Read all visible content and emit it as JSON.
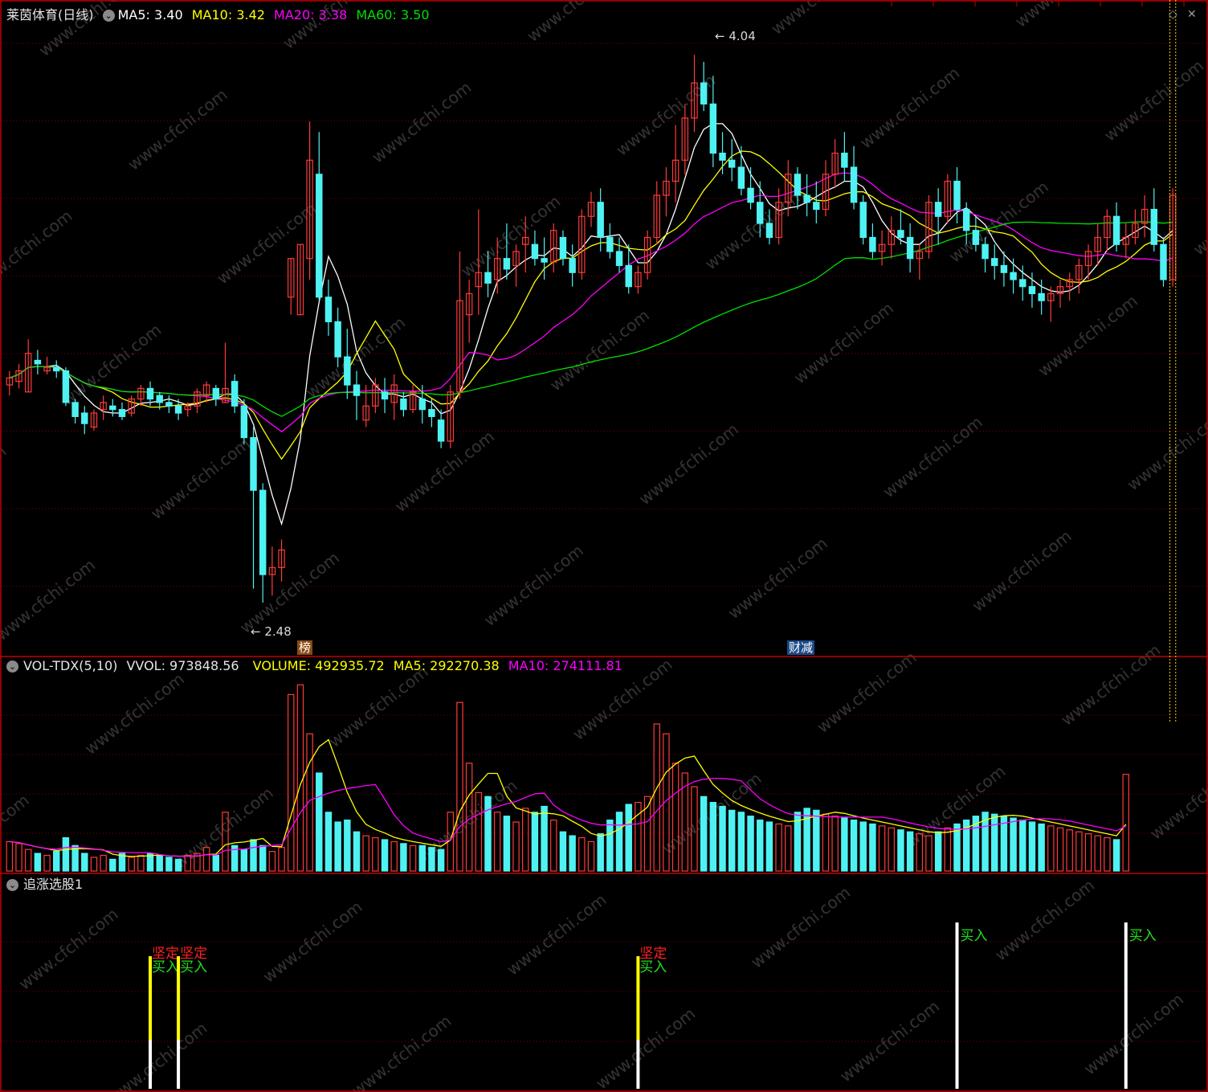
{
  "header": {
    "title": "莱茵体育",
    "period": "(日线)",
    "ma": [
      {
        "label": "MA5: 3.40",
        "color": "#ffffff"
      },
      {
        "label": "MA10: 3.42",
        "color": "#ffff00"
      },
      {
        "label": "MA20: 3.38",
        "color": "#ff00ff"
      },
      {
        "label": "MA60: 3.50",
        "color": "#00e000"
      }
    ]
  },
  "price_panel": {
    "high_label": "4.04",
    "low_label": "2.48",
    "tags": [
      "榜",
      "财减"
    ]
  },
  "volume_panel": {
    "name": "VOL-TDX(5,10)",
    "vvol": "VVOL: 973848.56",
    "volume": "VOLUME: 492935.72",
    "ma5": "MA5: 292270.38",
    "ma10": "MA10: 274111.81"
  },
  "signal_panel": {
    "name": "追涨选股1"
  },
  "watermark": "www.cfchi.com",
  "colors": {
    "up": "#ff3a3a",
    "down": "#4ff2f2",
    "frame": "#c00000",
    "grid": "#7a0000",
    "ma5": "#ffffff",
    "ma10": "#ffff00",
    "ma20": "#ff00ff",
    "ma60": "#00e000"
  },
  "chart_data": {
    "type": "candlestick",
    "ylim": [
      2.4,
      4.1
    ],
    "ylim_volume": [
      0,
      1000000
    ],
    "candles": [
      {
        "o": 3.1,
        "h": 3.14,
        "l": 3.07,
        "c": 3.12
      },
      {
        "o": 3.11,
        "h": 3.16,
        "l": 3.09,
        "c": 3.14
      },
      {
        "o": 3.08,
        "h": 3.23,
        "l": 3.08,
        "c": 3.19
      },
      {
        "o": 3.17,
        "h": 3.2,
        "l": 3.13,
        "c": 3.16
      },
      {
        "o": 3.14,
        "h": 3.18,
        "l": 3.13,
        "c": 3.15
      },
      {
        "o": 3.15,
        "h": 3.17,
        "l": 3.12,
        "c": 3.14
      },
      {
        "o": 3.14,
        "h": 3.15,
        "l": 3.04,
        "c": 3.05
      },
      {
        "o": 3.05,
        "h": 3.06,
        "l": 2.99,
        "c": 3.01
      },
      {
        "o": 3.02,
        "h": 3.04,
        "l": 2.96,
        "c": 2.99
      },
      {
        "o": 2.98,
        "h": 3.03,
        "l": 2.97,
        "c": 3.02
      },
      {
        "o": 3.03,
        "h": 3.07,
        "l": 3.0,
        "c": 3.05
      },
      {
        "o": 3.04,
        "h": 3.06,
        "l": 3.01,
        "c": 3.03
      },
      {
        "o": 3.03,
        "h": 3.05,
        "l": 3.0,
        "c": 3.01
      },
      {
        "o": 3.02,
        "h": 3.07,
        "l": 3.01,
        "c": 3.06
      },
      {
        "o": 3.06,
        "h": 3.1,
        "l": 3.04,
        "c": 3.09
      },
      {
        "o": 3.09,
        "h": 3.11,
        "l": 3.04,
        "c": 3.06
      },
      {
        "o": 3.07,
        "h": 3.08,
        "l": 3.03,
        "c": 3.05
      },
      {
        "o": 3.05,
        "h": 3.07,
        "l": 3.02,
        "c": 3.04
      },
      {
        "o": 3.04,
        "h": 3.06,
        "l": 3.0,
        "c": 3.02
      },
      {
        "o": 3.03,
        "h": 3.05,
        "l": 3.01,
        "c": 3.04
      },
      {
        "o": 3.04,
        "h": 3.09,
        "l": 3.02,
        "c": 3.08
      },
      {
        "o": 3.07,
        "h": 3.11,
        "l": 3.05,
        "c": 3.1
      },
      {
        "o": 3.09,
        "h": 3.1,
        "l": 3.04,
        "c": 3.06
      },
      {
        "o": 3.05,
        "h": 3.22,
        "l": 3.05,
        "c": 3.09
      },
      {
        "o": 3.11,
        "h": 3.13,
        "l": 3.02,
        "c": 3.04
      },
      {
        "o": 3.04,
        "h": 3.06,
        "l": 2.93,
        "c": 2.95
      },
      {
        "o": 2.95,
        "h": 2.98,
        "l": 2.52,
        "c": 2.8
      },
      {
        "o": 2.8,
        "h": 2.82,
        "l": 2.48,
        "c": 2.56
      },
      {
        "o": 2.56,
        "h": 2.64,
        "l": 2.5,
        "c": 2.58
      },
      {
        "o": 2.58,
        "h": 2.66,
        "l": 2.54,
        "c": 2.63
      },
      {
        "o": 3.35,
        "h": 3.46,
        "l": 3.3,
        "c": 3.46
      },
      {
        "o": 3.3,
        "h": 3.5,
        "l": 3.3,
        "c": 3.5
      },
      {
        "o": 3.46,
        "h": 3.85,
        "l": 3.4,
        "c": 3.74
      },
      {
        "o": 3.7,
        "h": 3.82,
        "l": 3.34,
        "c": 3.35
      },
      {
        "o": 3.35,
        "h": 3.4,
        "l": 3.24,
        "c": 3.28
      },
      {
        "o": 3.28,
        "h": 3.32,
        "l": 3.15,
        "c": 3.18
      },
      {
        "o": 3.18,
        "h": 3.26,
        "l": 3.06,
        "c": 3.1
      },
      {
        "o": 3.1,
        "h": 3.14,
        "l": 3.0,
        "c": 3.07
      },
      {
        "o": 3.0,
        "h": 3.1,
        "l": 2.98,
        "c": 3.04
      },
      {
        "o": 3.04,
        "h": 3.12,
        "l": 3.02,
        "c": 3.1
      },
      {
        "o": 3.08,
        "h": 3.12,
        "l": 3.02,
        "c": 3.06
      },
      {
        "o": 3.05,
        "h": 3.13,
        "l": 3.0,
        "c": 3.1
      },
      {
        "o": 3.06,
        "h": 3.08,
        "l": 3.01,
        "c": 3.03
      },
      {
        "o": 3.03,
        "h": 3.1,
        "l": 3.02,
        "c": 3.08
      },
      {
        "o": 3.06,
        "h": 3.1,
        "l": 2.99,
        "c": 3.03
      },
      {
        "o": 3.03,
        "h": 3.06,
        "l": 2.98,
        "c": 3.01
      },
      {
        "o": 3.0,
        "h": 3.03,
        "l": 2.92,
        "c": 2.94
      },
      {
        "o": 2.94,
        "h": 3.1,
        "l": 2.92,
        "c": 3.08
      },
      {
        "o": 3.08,
        "h": 3.48,
        "l": 3.06,
        "c": 3.34
      },
      {
        "o": 3.3,
        "h": 3.4,
        "l": 3.22,
        "c": 3.36
      },
      {
        "o": 3.38,
        "h": 3.6,
        "l": 3.3,
        "c": 3.42
      },
      {
        "o": 3.42,
        "h": 3.48,
        "l": 3.35,
        "c": 3.39
      },
      {
        "o": 3.4,
        "h": 3.52,
        "l": 3.36,
        "c": 3.46
      },
      {
        "o": 3.46,
        "h": 3.56,
        "l": 3.4,
        "c": 3.43
      },
      {
        "o": 3.44,
        "h": 3.5,
        "l": 3.38,
        "c": 3.48
      },
      {
        "o": 3.5,
        "h": 3.58,
        "l": 3.42,
        "c": 3.52
      },
      {
        "o": 3.5,
        "h": 3.54,
        "l": 3.44,
        "c": 3.46
      },
      {
        "o": 3.46,
        "h": 3.52,
        "l": 3.4,
        "c": 3.45
      },
      {
        "o": 3.45,
        "h": 3.56,
        "l": 3.42,
        "c": 3.54
      },
      {
        "o": 3.52,
        "h": 3.54,
        "l": 3.44,
        "c": 3.46
      },
      {
        "o": 3.46,
        "h": 3.5,
        "l": 3.38,
        "c": 3.42
      },
      {
        "o": 3.42,
        "h": 3.6,
        "l": 3.4,
        "c": 3.58
      },
      {
        "o": 3.58,
        "h": 3.65,
        "l": 3.55,
        "c": 3.62
      },
      {
        "o": 3.62,
        "h": 3.66,
        "l": 3.48,
        "c": 3.52
      },
      {
        "o": 3.52,
        "h": 3.56,
        "l": 3.46,
        "c": 3.48
      },
      {
        "o": 3.48,
        "h": 3.52,
        "l": 3.42,
        "c": 3.44
      },
      {
        "o": 3.44,
        "h": 3.5,
        "l": 3.36,
        "c": 3.38
      },
      {
        "o": 3.38,
        "h": 3.44,
        "l": 3.36,
        "c": 3.42
      },
      {
        "o": 3.42,
        "h": 3.54,
        "l": 3.4,
        "c": 3.52
      },
      {
        "o": 3.52,
        "h": 3.68,
        "l": 3.5,
        "c": 3.64
      },
      {
        "o": 3.64,
        "h": 3.72,
        "l": 3.58,
        "c": 3.68
      },
      {
        "o": 3.68,
        "h": 3.84,
        "l": 3.62,
        "c": 3.74
      },
      {
        "o": 3.74,
        "h": 3.9,
        "l": 3.7,
        "c": 3.86
      },
      {
        "o": 3.86,
        "h": 4.04,
        "l": 3.82,
        "c": 3.96
      },
      {
        "o": 3.96,
        "h": 4.02,
        "l": 3.88,
        "c": 3.9
      },
      {
        "o": 3.9,
        "h": 3.98,
        "l": 3.72,
        "c": 3.76
      },
      {
        "o": 3.76,
        "h": 3.82,
        "l": 3.7,
        "c": 3.74
      },
      {
        "o": 3.74,
        "h": 3.8,
        "l": 3.68,
        "c": 3.72
      },
      {
        "o": 3.72,
        "h": 3.78,
        "l": 3.64,
        "c": 3.66
      },
      {
        "o": 3.66,
        "h": 3.72,
        "l": 3.6,
        "c": 3.62
      },
      {
        "o": 3.62,
        "h": 3.68,
        "l": 3.52,
        "c": 3.56
      },
      {
        "o": 3.56,
        "h": 3.6,
        "l": 3.5,
        "c": 3.52
      },
      {
        "o": 3.52,
        "h": 3.66,
        "l": 3.5,
        "c": 3.62
      },
      {
        "o": 3.62,
        "h": 3.74,
        "l": 3.58,
        "c": 3.7
      },
      {
        "o": 3.7,
        "h": 3.72,
        "l": 3.6,
        "c": 3.64
      },
      {
        "o": 3.64,
        "h": 3.7,
        "l": 3.58,
        "c": 3.62
      },
      {
        "o": 3.62,
        "h": 3.68,
        "l": 3.56,
        "c": 3.6
      },
      {
        "o": 3.6,
        "h": 3.74,
        "l": 3.58,
        "c": 3.7
      },
      {
        "o": 3.7,
        "h": 3.8,
        "l": 3.66,
        "c": 3.76
      },
      {
        "o": 3.76,
        "h": 3.82,
        "l": 3.68,
        "c": 3.72
      },
      {
        "o": 3.72,
        "h": 3.78,
        "l": 3.6,
        "c": 3.62
      },
      {
        "o": 3.62,
        "h": 3.64,
        "l": 3.5,
        "c": 3.52
      },
      {
        "o": 3.52,
        "h": 3.56,
        "l": 3.46,
        "c": 3.48
      },
      {
        "o": 3.48,
        "h": 3.54,
        "l": 3.44,
        "c": 3.5
      },
      {
        "o": 3.5,
        "h": 3.58,
        "l": 3.46,
        "c": 3.54
      },
      {
        "o": 3.54,
        "h": 3.6,
        "l": 3.5,
        "c": 3.52
      },
      {
        "o": 3.52,
        "h": 3.56,
        "l": 3.42,
        "c": 3.46
      },
      {
        "o": 3.46,
        "h": 3.5,
        "l": 3.4,
        "c": 3.48
      },
      {
        "o": 3.48,
        "h": 3.64,
        "l": 3.46,
        "c": 3.62
      },
      {
        "o": 3.62,
        "h": 3.66,
        "l": 3.5,
        "c": 3.58
      },
      {
        "o": 3.58,
        "h": 3.7,
        "l": 3.56,
        "c": 3.68
      },
      {
        "o": 3.68,
        "h": 3.72,
        "l": 3.56,
        "c": 3.6
      },
      {
        "o": 3.6,
        "h": 3.62,
        "l": 3.5,
        "c": 3.54
      },
      {
        "o": 3.54,
        "h": 3.58,
        "l": 3.48,
        "c": 3.5
      },
      {
        "o": 3.5,
        "h": 3.52,
        "l": 3.42,
        "c": 3.46
      },
      {
        "o": 3.46,
        "h": 3.5,
        "l": 3.4,
        "c": 3.44
      },
      {
        "o": 3.44,
        "h": 3.48,
        "l": 3.38,
        "c": 3.42
      },
      {
        "o": 3.42,
        "h": 3.46,
        "l": 3.36,
        "c": 3.4
      },
      {
        "o": 3.4,
        "h": 3.44,
        "l": 3.34,
        "c": 3.38
      },
      {
        "o": 3.38,
        "h": 3.42,
        "l": 3.32,
        "c": 3.36
      },
      {
        "o": 3.36,
        "h": 3.4,
        "l": 3.3,
        "c": 3.34
      },
      {
        "o": 3.34,
        "h": 3.38,
        "l": 3.28,
        "c": 3.36
      },
      {
        "o": 3.36,
        "h": 3.4,
        "l": 3.32,
        "c": 3.38
      },
      {
        "o": 3.38,
        "h": 3.42,
        "l": 3.34,
        "c": 3.4
      },
      {
        "o": 3.4,
        "h": 3.46,
        "l": 3.36,
        "c": 3.44
      },
      {
        "o": 3.44,
        "h": 3.5,
        "l": 3.4,
        "c": 3.48
      },
      {
        "o": 3.48,
        "h": 3.56,
        "l": 3.44,
        "c": 3.52
      },
      {
        "o": 3.52,
        "h": 3.6,
        "l": 3.48,
        "c": 3.58
      },
      {
        "o": 3.58,
        "h": 3.62,
        "l": 3.48,
        "c": 3.5
      },
      {
        "o": 3.5,
        "h": 3.56,
        "l": 3.46,
        "c": 3.52
      },
      {
        "o": 3.52,
        "h": 3.6,
        "l": 3.5,
        "c": 3.56
      },
      {
        "o": 3.56,
        "h": 3.64,
        "l": 3.52,
        "c": 3.6
      },
      {
        "o": 3.6,
        "h": 3.66,
        "l": 3.48,
        "c": 3.5
      },
      {
        "o": 3.5,
        "h": 3.52,
        "l": 3.38,
        "c": 3.4
      },
      {
        "o": 3.4,
        "h": 3.66,
        "l": 3.38,
        "c": 3.64
      }
    ],
    "volumes": [
      150000,
      140000,
      110000,
      90000,
      80000,
      100000,
      170000,
      130000,
      90000,
      70000,
      80000,
      60000,
      90000,
      70000,
      80000,
      90000,
      80000,
      70000,
      60000,
      80000,
      90000,
      120000,
      80000,
      300000,
      130000,
      110000,
      160000,
      130000,
      100000,
      120000,
      900000,
      950000,
      700000,
      500000,
      300000,
      250000,
      260000,
      200000,
      180000,
      170000,
      160000,
      150000,
      140000,
      130000,
      130000,
      120000,
      110000,
      300000,
      860000,
      550000,
      400000,
      380000,
      300000,
      280000,
      250000,
      320000,
      300000,
      330000,
      260000,
      200000,
      180000,
      170000,
      150000,
      190000,
      260000,
      300000,
      340000,
      350000,
      380000,
      750000,
      700000,
      550000,
      500000,
      430000,
      380000,
      350000,
      330000,
      310000,
      300000,
      280000,
      260000,
      250000,
      240000,
      230000,
      300000,
      320000,
      310000,
      290000,
      280000,
      270000,
      260000,
      250000,
      240000,
      230000,
      220000,
      210000,
      200000,
      190000,
      180000,
      200000,
      220000,
      240000,
      260000,
      280000,
      300000,
      290000,
      280000,
      270000,
      260000,
      250000,
      240000,
      230000,
      220000,
      210000,
      200000,
      190000,
      180000,
      170000,
      160000,
      492935
    ],
    "signals": [
      {
        "index": 15,
        "text_top": "坚定",
        "text_bottom": "买入",
        "top_color": "#ffff00"
      },
      {
        "index": 18,
        "text_top": "坚定",
        "text_bottom": "买入",
        "top_color": "#ffff00"
      },
      {
        "index": 67,
        "text_top": "坚定",
        "text_bottom": "买入",
        "top_color": "#ffff00"
      },
      {
        "index": 101,
        "text_top": "",
        "text_bottom": "买入",
        "top_color": "#ffffff"
      },
      {
        "index": 119,
        "text_top": "",
        "text_bottom": "买入",
        "top_color": "#ffffff"
      }
    ]
  }
}
